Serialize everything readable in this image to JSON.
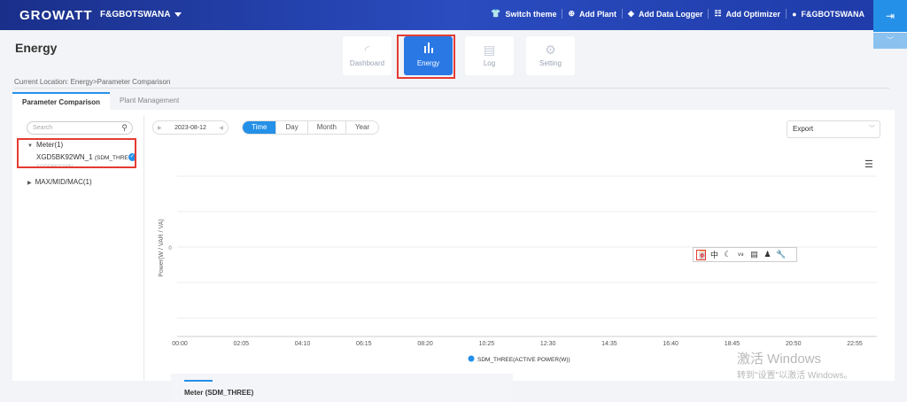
{
  "header": {
    "logo": "GROWATT",
    "account": "F&GBOTSWANA",
    "links": [
      {
        "icon": "shirt-icon",
        "label": "Switch theme"
      },
      {
        "icon": "plus-circle-icon",
        "label": "Add Plant"
      },
      {
        "icon": "tag-icon",
        "label": "Add Data Logger"
      },
      {
        "icon": "optimizer-icon",
        "label": "Add Optimizer"
      },
      {
        "icon": "user-icon",
        "label": "F&GBOTSWANA"
      }
    ]
  },
  "page": {
    "title": "Energy",
    "breadcrumb": "Current Location: Energy>Parameter Comparison"
  },
  "modules": [
    {
      "label": "Dashboard",
      "icon": "gauge-icon"
    },
    {
      "label": "Energy",
      "icon": "bar-chart-icon",
      "active": true
    },
    {
      "label": "Log",
      "icon": "log-icon"
    },
    {
      "label": "Setting",
      "icon": "gear-icon"
    }
  ],
  "tabs": [
    {
      "label": "Parameter Comparison",
      "active": true
    },
    {
      "label": "Plant Management"
    }
  ],
  "sidebar": {
    "search_placeholder": "Search",
    "tree": {
      "meter_group": "Meter(1)",
      "device_name": "XGD5BK92WN_1",
      "device_type": "(SDM_THRE",
      "device_serial": "XGD5BK92WN",
      "badge": "✓",
      "mac_group": "MAX/MID/MAC(1)"
    }
  },
  "toolbar": {
    "date": "2023-08-12",
    "periods": [
      "Time",
      "Day",
      "Month",
      "Year"
    ],
    "active_period": "Time",
    "export": "Export"
  },
  "chart_data": {
    "type": "line",
    "ylabel": "Power(W / VAR / VA)",
    "y_ticks": [
      "0"
    ],
    "x_ticks": [
      "00:00",
      "02:05",
      "04:10",
      "06:15",
      "08:20",
      "10:25",
      "12:30",
      "14:35",
      "16:40",
      "18:45",
      "20:50",
      "22:55"
    ],
    "series": [
      {
        "name": "SDM_THREE(ACTIVE POWER(W))",
        "values": [],
        "color": "#2590e8"
      }
    ]
  },
  "chart_toolbox": [
    "中",
    "☾",
    "ᵛ⁹",
    "▤",
    "♟",
    "🔧"
  ],
  "meter_section": {
    "title": "Meter (SDM_THREE)"
  },
  "watermark": {
    "line1": "激活 Windows",
    "line2": "转到\"设置\"以激活 Windows。"
  }
}
